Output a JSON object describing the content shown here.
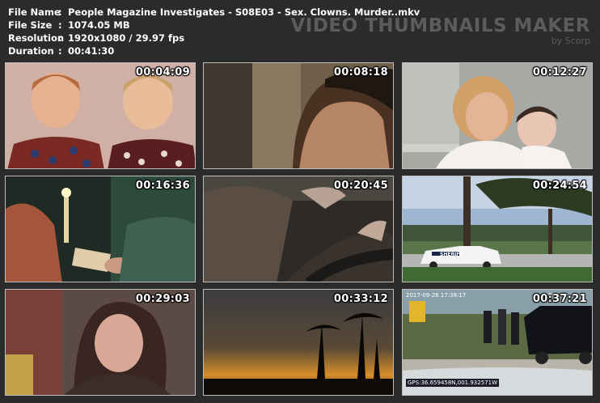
{
  "file_info": {
    "file_name_label": "File Name",
    "file_name": "People Magazine Investigates - S08E03 - Sex. Clowns. Murder..mkv",
    "file_size_label": "File Size",
    "file_size": "1074.05 MB",
    "resolution_label": "Resolution",
    "resolution": "1920x1080 / 29.97 fps",
    "duration_label": "Duration",
    "duration": "00:41:30",
    "separator": ":"
  },
  "brand": {
    "title": "VIDEO THUMBNAILS MAKER",
    "by": "by Scorp"
  },
  "thumbnails": [
    {
      "timestamp": "00:04:09",
      "scene": "two-boys-photo"
    },
    {
      "timestamp": "00:08:18",
      "scene": "woman-back"
    },
    {
      "timestamp": "00:12:27",
      "scene": "mother-baby"
    },
    {
      "timestamp": "00:16:36",
      "scene": "candle-letter"
    },
    {
      "timestamp": "00:20:45",
      "scene": "steering-wheel"
    },
    {
      "timestamp": "00:24:54",
      "scene": "sheriff-parking"
    },
    {
      "timestamp": "00:29:03",
      "scene": "woman-interview"
    },
    {
      "timestamp": "00:33:12",
      "scene": "palm-sunset"
    },
    {
      "timestamp": "00:37:21",
      "scene": "dashcam-arrest"
    }
  ],
  "overlays": {
    "sheriff_text": "SHERIFF",
    "dashcam_top": "2017-09-26 17:38:17",
    "dashcam_unit": "687",
    "dashcam_gps": "GPS:36.659458N,001.932571W"
  },
  "colors": {
    "background": "#2b2b2b",
    "brand": "#5c5c5c",
    "thumb_border": "#bdbdbd"
  }
}
